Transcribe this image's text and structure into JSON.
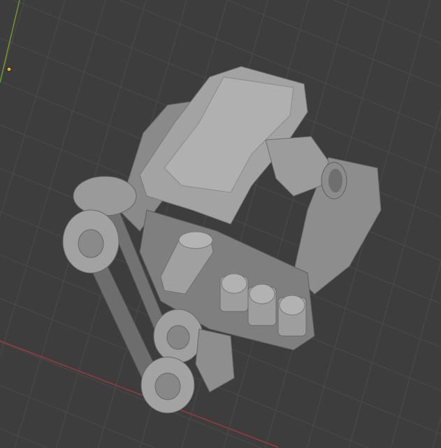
{
  "viewport": {
    "background_color": "#3d3d3d",
    "grid_color": "#4b4b4b",
    "x_axis_color": "#9b3a3f",
    "y_axis_color": "#6e9a2a",
    "origin_color": "#f0b020",
    "model_color": "#9a9a9a"
  }
}
